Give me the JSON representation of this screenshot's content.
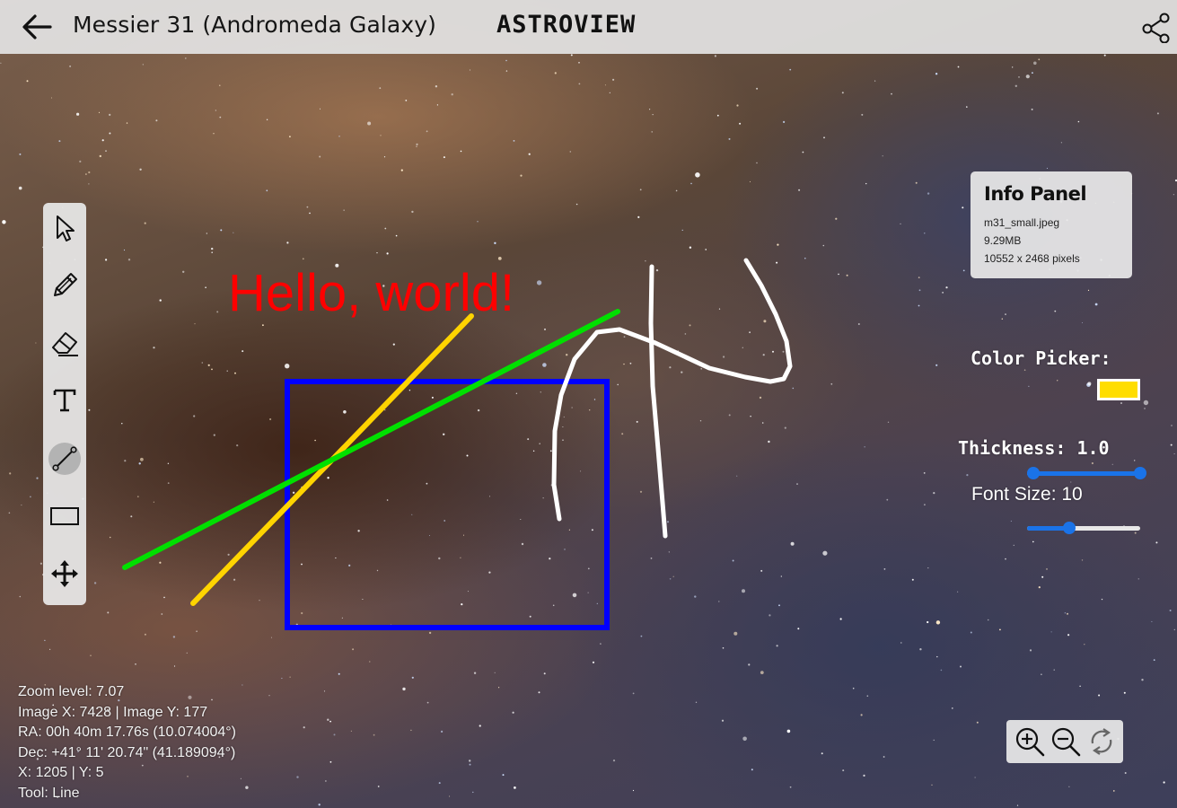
{
  "header": {
    "title": "Messier 31 (Andromeda Galaxy)",
    "brand": "ASTROVIEW",
    "back_icon": "arrow-left-icon",
    "share_icon": "share-icon"
  },
  "toolbar": {
    "active_tool": "line",
    "tools": [
      {
        "name": "select",
        "icon": "cursor-icon"
      },
      {
        "name": "pencil",
        "icon": "pencil-icon"
      },
      {
        "name": "eraser",
        "icon": "eraser-icon"
      },
      {
        "name": "text",
        "icon": "text-icon"
      },
      {
        "name": "line",
        "icon": "line-icon"
      },
      {
        "name": "rectangle",
        "icon": "rectangle-icon"
      },
      {
        "name": "move",
        "icon": "move-icon"
      }
    ]
  },
  "canvas": {
    "text_annotation": "Hello, world!",
    "colors": {
      "text": "#ff0000",
      "yellow_line": "#ffd400",
      "green_line": "#00e000",
      "rectangle": "#0000ff",
      "freehand": "#ffffff"
    }
  },
  "info_panel": {
    "title": "Info Panel",
    "filename": "m31_small.jpeg",
    "size": "9.29MB",
    "dimensions": "10552 x 2468 pixels"
  },
  "controls": {
    "color_label": "Color Picker:",
    "color_value": "#ffdd00",
    "thickness_label": "Thickness: 1.0",
    "thickness_value": 1.0,
    "font_size_label": "Font Size: 10",
    "font_size_value": 10
  },
  "status": {
    "zoom": "Zoom level: 7.07",
    "image_xy": "Image X: 7428 | Image Y: 177",
    "ra": "RA: 00h 40m 17.76s (10.074004°)",
    "dec": "Dec: +41° 11' 20.74\" (41.189094°)",
    "xy": "X: 1205 | Y: 5",
    "tool": "Tool: Line"
  },
  "zoom_controls": {
    "zoom_in_icon": "zoom-in-icon",
    "zoom_out_icon": "zoom-out-icon",
    "reset_icon": "reset-icon"
  }
}
